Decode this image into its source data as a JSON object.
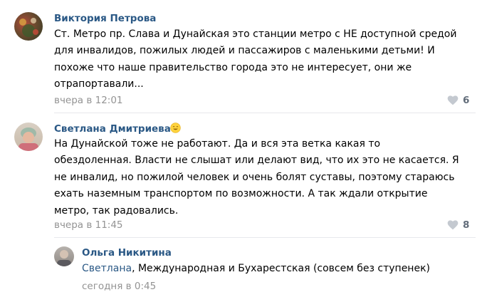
{
  "comments": [
    {
      "author": "Виктория Петрова",
      "lines": [
        "Ст. Метро пр. Слава и Дунайская это станции метро с НЕ доступной средой",
        "для инвалидов, пожилых людей и пассажиров с маленькими детьми! И",
        "похоже что наше правительство города это не интересует, они же",
        "отрапортавали..."
      ],
      "time": "вчера в 12:01",
      "likes": "6"
    },
    {
      "author": "Светлана Дмитриева",
      "lines": [
        "На Дунайской тоже не работают. Да и вся эта ветка какая то",
        "обездоленная. Власти не слышат или делают вид, что их это не касается. Я",
        "не инвалид, но пожилой человек и очень болят суставы, поэтому стараюсь",
        "ехать наземным транспортом по возможности. А так ждали открытие",
        "метро, так радовались."
      ],
      "time": "вчера в 11:45",
      "likes": "8"
    }
  ],
  "reply": {
    "author": "Ольга Никитина",
    "mention": "Светлана",
    "text": ", Международная и Бухарестская (совсем без ступенек)",
    "time": "сегодня в 0:45"
  },
  "colors": {
    "link": "#2a5885",
    "meta": "#939393",
    "like_icon": "#c4c9d0",
    "divider": "#e7e8ec"
  },
  "icons": [
    "heart-icon",
    "smile-emoji-icon"
  ]
}
